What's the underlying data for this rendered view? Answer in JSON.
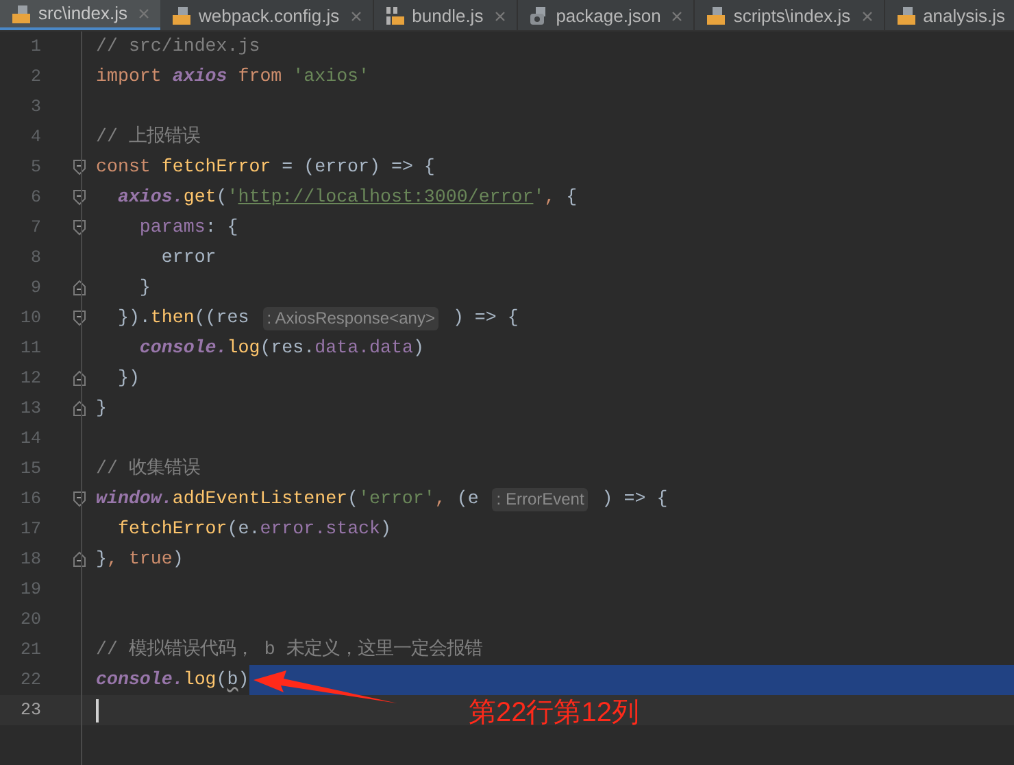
{
  "tabs": [
    {
      "label": "src\\index.js",
      "kind": "js",
      "selected": true
    },
    {
      "label": "webpack.config.js",
      "kind": "js",
      "selected": false
    },
    {
      "label": "bundle.js",
      "kind": "binary",
      "selected": false
    },
    {
      "label": "package.json",
      "kind": "json",
      "selected": false
    },
    {
      "label": "scripts\\index.js",
      "kind": "js",
      "selected": false
    },
    {
      "label": "analysis.js",
      "kind": "js",
      "selected": false
    }
  ],
  "lines": [
    {
      "number": "1",
      "tokens": [
        {
          "kind": "comment",
          "text": "// src/index.js"
        }
      ]
    },
    {
      "number": "2",
      "tokens": [
        {
          "kind": "keyword",
          "text": "import "
        },
        {
          "kind": "global",
          "text": "axios"
        },
        {
          "kind": "keyword",
          "text": " from "
        },
        {
          "kind": "string",
          "text": "'axios'"
        }
      ]
    },
    {
      "number": "3"
    },
    {
      "number": "4",
      "tokens": [
        {
          "kind": "comment",
          "text": "// 上报错误"
        }
      ]
    },
    {
      "number": "5",
      "kind": "opener",
      "tokens": [
        {
          "kind": "keyword",
          "text": "const "
        },
        {
          "kind": "function",
          "text": "fetchError"
        },
        {
          "kind": "plain",
          "text": " = (error) => {"
        }
      ]
    },
    {
      "number": "6",
      "kind": "opener",
      "tokens": [
        {
          "kind": "global",
          "text": "  axios."
        },
        {
          "kind": "function",
          "text": "get"
        },
        {
          "kind": "plain",
          "text": "("
        },
        {
          "kind": "string",
          "text": "'"
        },
        {
          "kind": "url",
          "text": "http://localhost:3000/error"
        },
        {
          "kind": "string",
          "text": "'"
        },
        {
          "kind": "keyword",
          "text": ","
        },
        {
          "kind": "plain",
          "text": " {"
        }
      ]
    },
    {
      "number": "7",
      "kind": "opener",
      "tokens": [
        {
          "kind": "field",
          "text": "    params"
        },
        {
          "kind": "plain",
          "text": ": {"
        }
      ]
    },
    {
      "number": "8",
      "tokens": [
        {
          "kind": "plain",
          "text": "      error"
        }
      ]
    },
    {
      "number": "9",
      "kind": "closer",
      "tokens": [
        {
          "kind": "plain",
          "text": "    }"
        }
      ]
    },
    {
      "number": "10",
      "kind": "opener",
      "tokens": [
        {
          "kind": "plain",
          "text": "  })."
        },
        {
          "kind": "function",
          "text": "then"
        },
        {
          "kind": "plain",
          "text": "((res "
        },
        {
          "kind": "hint",
          "text": ": AxiosResponse<any>"
        },
        {
          "kind": "plain",
          "text": " ) => {"
        }
      ]
    },
    {
      "number": "11",
      "tokens": [
        {
          "kind": "global",
          "text": "    console."
        },
        {
          "kind": "function",
          "text": "log"
        },
        {
          "kind": "plain",
          "text": "(res."
        },
        {
          "kind": "field",
          "text": "data"
        },
        {
          "kind": "field",
          "text": ".data"
        },
        {
          "kind": "plain",
          "text": ")"
        }
      ]
    },
    {
      "number": "12",
      "kind": "closer",
      "tokens": [
        {
          "kind": "plain",
          "text": "  })"
        }
      ]
    },
    {
      "number": "13",
      "kind": "closer",
      "tokens": [
        {
          "kind": "plain",
          "text": "}"
        }
      ]
    },
    {
      "number": "14"
    },
    {
      "number": "15",
      "tokens": [
        {
          "kind": "comment",
          "text": "// 收集错误"
        }
      ]
    },
    {
      "number": "16",
      "kind": "opener",
      "tokens": [
        {
          "kind": "global",
          "text": "window."
        },
        {
          "kind": "function",
          "text": "addEventListener"
        },
        {
          "kind": "plain",
          "text": "("
        },
        {
          "kind": "string",
          "text": "'error'"
        },
        {
          "kind": "keyword",
          "text": ","
        },
        {
          "kind": "plain",
          "text": " (e "
        },
        {
          "kind": "hint",
          "text": ": ErrorEvent"
        },
        {
          "kind": "plain",
          "text": " ) => {"
        }
      ]
    },
    {
      "number": "17",
      "tokens": [
        {
          "kind": "function",
          "text": "  fetchError"
        },
        {
          "kind": "plain",
          "text": "(e."
        },
        {
          "kind": "field",
          "text": "error"
        },
        {
          "kind": "field",
          "text": ".stack"
        },
        {
          "kind": "plain",
          "text": ")"
        }
      ]
    },
    {
      "number": "18",
      "kind": "closer",
      "tokens": [
        {
          "kind": "plain",
          "text": "}"
        },
        {
          "kind": "keyword",
          "text": ", true"
        },
        {
          "kind": "plain",
          "text": ")"
        }
      ]
    },
    {
      "number": "19"
    },
    {
      "number": "20"
    },
    {
      "number": "21",
      "tokens": [
        {
          "kind": "comment",
          "text": "// 模拟错误代码， b 未定义，这里一定会报错"
        }
      ]
    },
    {
      "number": "22",
      "highlighted": true,
      "tokens": [
        {
          "kind": "global",
          "text": "console."
        },
        {
          "kind": "function",
          "text": "log"
        },
        {
          "kind": "plain",
          "text": "("
        },
        {
          "kind": "undefined",
          "text": "b"
        },
        {
          "kind": "plain",
          "text": ")"
        }
      ]
    },
    {
      "number": "23",
      "current": true
    }
  ],
  "annotation": {
    "text": "第22行第12列"
  }
}
